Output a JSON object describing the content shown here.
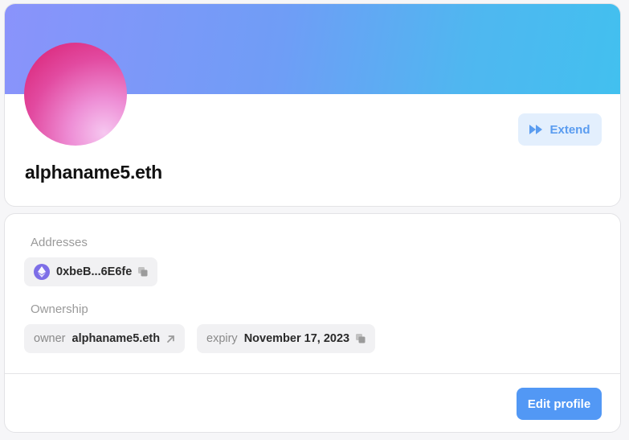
{
  "profile": {
    "name": "alphaname5.eth",
    "extend_label": "Extend",
    "banner_gradient": [
      "#8a93fb",
      "#42c0ef"
    ],
    "avatar_gradient": [
      "#d81d6f",
      "#f6c7f0"
    ]
  },
  "details": {
    "addresses_label": "Addresses",
    "address": {
      "icon": "ethereum-icon",
      "value": "0xbeB...6E6fe",
      "action_icon": "copy-icon"
    },
    "ownership_label": "Ownership",
    "owner": {
      "key": "owner",
      "value": "alphaname5.eth",
      "action_icon": "arrow-up-right-icon"
    },
    "expiry": {
      "key": "expiry",
      "value": "November 17, 2023",
      "action_icon": "copy-icon"
    },
    "edit_profile_label": "Edit profile"
  },
  "colors": {
    "accent": "#5298f5",
    "accent_soft": "#e3effd",
    "chip_bg": "#f1f1f3",
    "eth_purple": "#7d6ee7"
  }
}
